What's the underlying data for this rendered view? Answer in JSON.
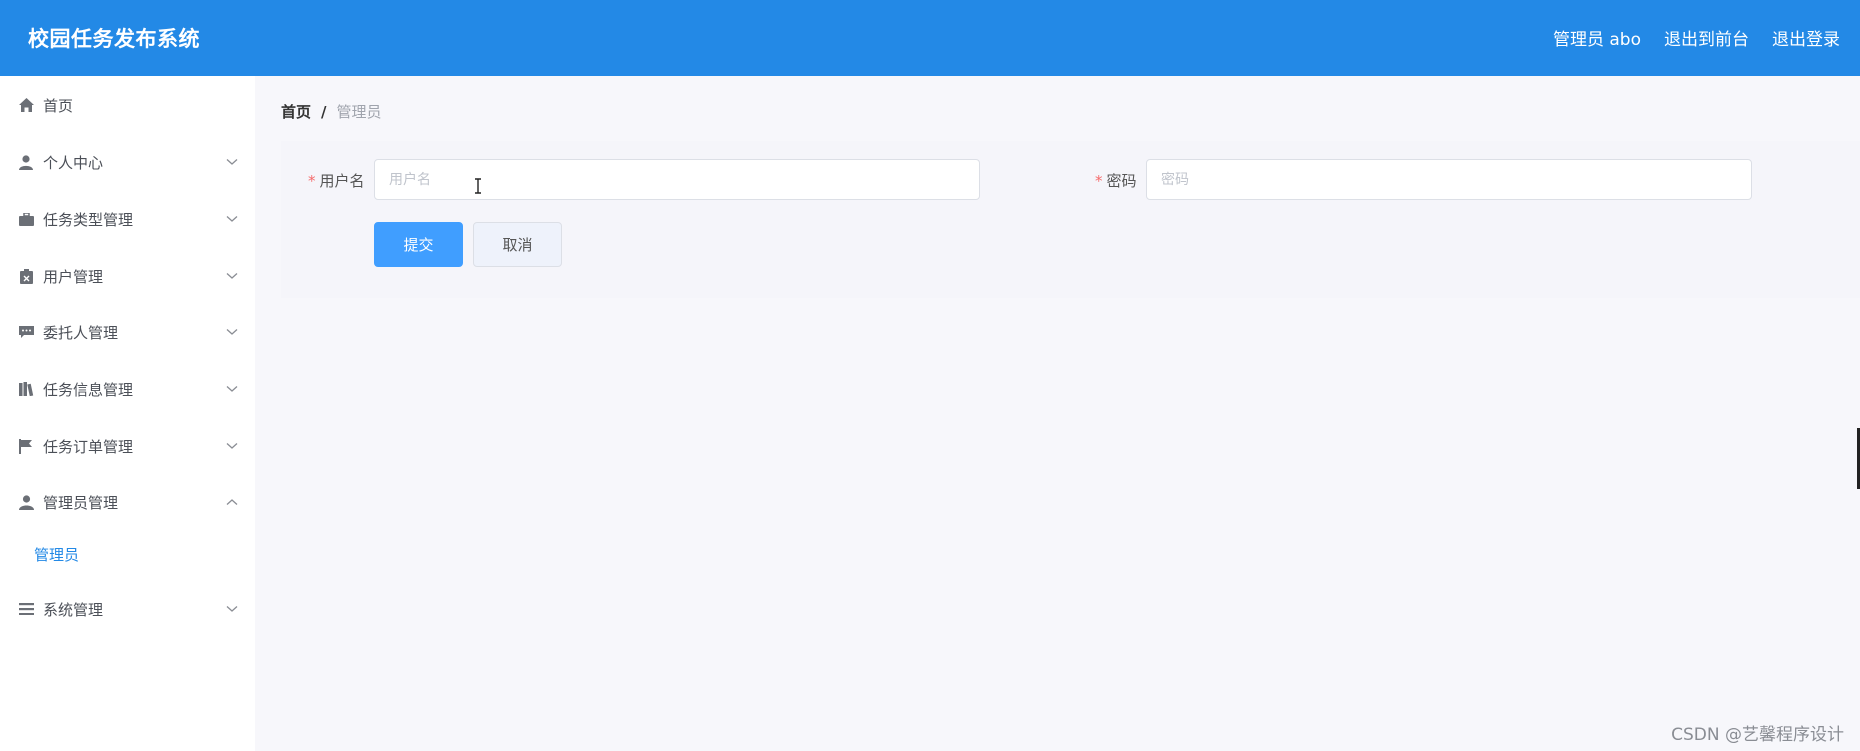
{
  "header": {
    "brand": "校园任务发布系统",
    "links": [
      "管理员 abo",
      "退出到前台",
      "退出登录"
    ]
  },
  "sidebar": {
    "items": [
      {
        "label": "首页",
        "icon": "home-icon",
        "has_children": false
      },
      {
        "label": "个人中心",
        "icon": "user-icon",
        "has_children": true,
        "expanded": false
      },
      {
        "label": "任务类型管理",
        "icon": "briefcase-icon",
        "has_children": true,
        "expanded": false
      },
      {
        "label": "用户管理",
        "icon": "clipboard-icon",
        "has_children": true,
        "expanded": false
      },
      {
        "label": "委托人管理",
        "icon": "chat-icon",
        "has_children": true,
        "expanded": false
      },
      {
        "label": "任务信息管理",
        "icon": "books-icon",
        "has_children": true,
        "expanded": false
      },
      {
        "label": "任务订单管理",
        "icon": "flag-icon",
        "has_children": true,
        "expanded": false
      },
      {
        "label": "管理员管理",
        "icon": "admin-icon",
        "has_children": true,
        "expanded": true
      },
      {
        "label": "系统管理",
        "icon": "list-icon",
        "has_children": true,
        "expanded": false
      }
    ],
    "submenu": {
      "label": "管理员"
    }
  },
  "breadcrumb": {
    "home": "首页",
    "separator": "/",
    "current": "管理员"
  },
  "form": {
    "username": {
      "label": "用户名",
      "placeholder": "用户名",
      "value": "",
      "required_mark": "*"
    },
    "password": {
      "label": "密码",
      "placeholder": "密码",
      "value": "",
      "required_mark": "*"
    },
    "submit_label": "提交",
    "cancel_label": "取消"
  },
  "watermark": "CSDN @艺馨程序设计",
  "colors": {
    "header": "#2389e6",
    "primary": "#409eff",
    "active_menu": "#2389e6",
    "required": "#f56c6c"
  }
}
